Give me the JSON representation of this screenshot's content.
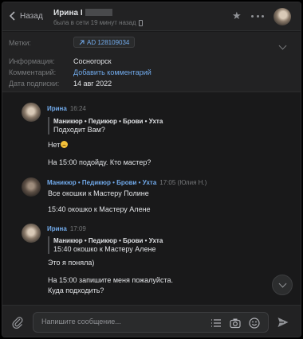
{
  "header": {
    "back_label": "Назад",
    "contact_name": "Ирина I",
    "status": "была в сети 19 минут назад"
  },
  "info": {
    "tags_label": "Метки:",
    "tag_value": "AD 128109034",
    "info_label": "Информация:",
    "info_value": "Сосногорск",
    "comment_label": "Комментарий:",
    "comment_link": "Добавить комментарий",
    "date_label": "Дата подписки:",
    "date_value": "14 авг 2022"
  },
  "messages": [
    {
      "sender": "Ирина",
      "time": "16:24",
      "quote_title": "Маникюр • Педикюр • Брови • Ухта",
      "quote_text": "Подходит Вам?",
      "lines": [
        "Нет",
        "На 15:00 подойду. Кто мастер?"
      ]
    },
    {
      "sender": "Маникюр • Педикюр • Брови • Ухта",
      "time": "17:05 (Юлия Н.)",
      "lines": [
        "Все окошки к Мастеру Полине",
        "15:40 окошко к Мастеру Алене"
      ]
    },
    {
      "sender": "Ирина",
      "time": "17:09",
      "quote_title": "Маникюр • Педикюр • Брови • Ухта",
      "quote_text": "15:40 окошко к Мастеру Алене",
      "lines": [
        "Это я поняла)",
        "На 15:00 запишите меня пожалуйста.",
        "Куда подходить?"
      ]
    }
  ],
  "composer": {
    "placeholder": "Напишите сообщение..."
  },
  "icons": {
    "back": "chevron-left-icon",
    "favorite": "star-icon",
    "more": "more-icon",
    "tag": "arrow-icon",
    "expand": "chevron-down-icon",
    "attach": "paperclip-icon",
    "templates": "list-icon",
    "camera": "camera-icon",
    "emoji": "smile-icon",
    "send": "send-icon",
    "scroll_down": "chevron-down-icon"
  },
  "colors": {
    "accent": "#71aaeb",
    "background": "#19191a",
    "panel": "#222223",
    "text": "#e1e3e6",
    "muted": "#76787a"
  }
}
